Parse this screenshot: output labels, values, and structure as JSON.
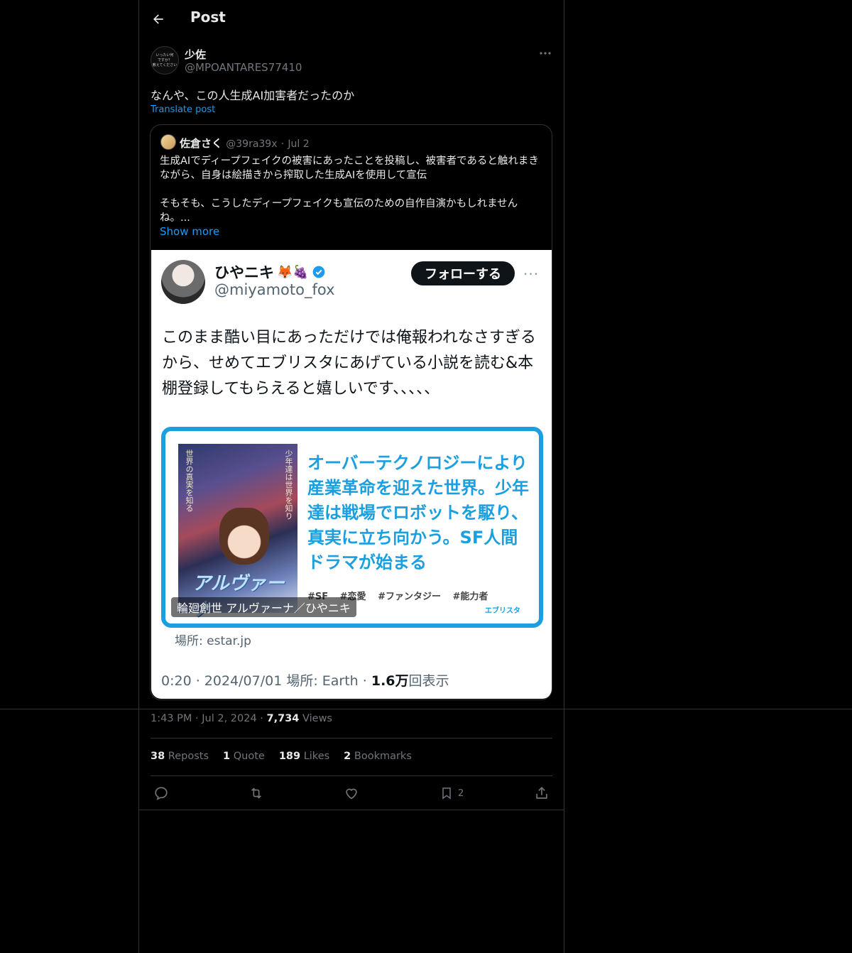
{
  "header": {
    "title": "Post"
  },
  "post": {
    "author_name": "少佐",
    "author_handle": "@MPOANTARES77410",
    "avatar_lines": [
      "いったい何",
      "ですか？",
      "教えてください"
    ],
    "text": "なんや、この人生成AI加害者だったのか",
    "translate_label": "Translate post",
    "timestamp": "1:43 PM · Jul 2, 2024 · ",
    "views_count": "7,734",
    "views_label": " Views"
  },
  "quoted": {
    "name": "佐倉さく",
    "handle": "@39ra39x",
    "date_separator": "·",
    "date": "Jul 2",
    "paragraphs": [
      "生成AIでディープフェイクの被害にあったことを投稿し、被害者であると触れまきながら、自身は絵描きから搾取した生成AIを使用して宣伝",
      "",
      "そもそも、こうしたディープフェイクも宣伝のための自作自演かもしれませんね。..."
    ],
    "show_more": "Show more"
  },
  "embedded": {
    "name": "ひやニキ",
    "emoji": "🦊🍇",
    "handle": "@miyamoto_fox",
    "follow_label": "フォローする",
    "more": "···",
    "text": "このまま酷い目にあっただけでは俺報われなさすぎるから、せめてエブリスタにあげている小説を読む&本棚登録してもらえると嬉しいです、、、、、",
    "card": {
      "cover_side_left": "世界の真実を知る",
      "cover_side_right": "少年達は世界を知り",
      "cover_title": "アルヴァーナ",
      "text": "オーバーテクノロジーにより産業革命を迎えた世界。少年達は戦場でロボットを駆り、真実に立ち向かう。SF人間ドラマが始まる",
      "tags": "#SF #恋愛 #ファンタジー #能力者",
      "logo": "エブリスタ",
      "caption": "輪廻創世 アルヴァーナ／ひやニキ"
    },
    "source": "場所: estar.jp",
    "meta_prefix": "0:20 · 2024/07/01 場所: Earth · ",
    "meta_views": "1.6万",
    "meta_suffix": "回表示"
  },
  "stats": {
    "reposts_count": "38",
    "reposts_label": " Reposts",
    "quote_count": "1",
    "quote_label": " Quote",
    "likes_count": "189",
    "likes_label": " Likes",
    "bookmarks_count": "2",
    "bookmarks_label": " Bookmarks"
  },
  "actions": {
    "bookmark_count": "2"
  },
  "colors": {
    "accent": "#1d9bf0",
    "background": "#000000",
    "border": "#2f3336",
    "muted": "#71767b",
    "card_blue": "#1a9fe0"
  }
}
